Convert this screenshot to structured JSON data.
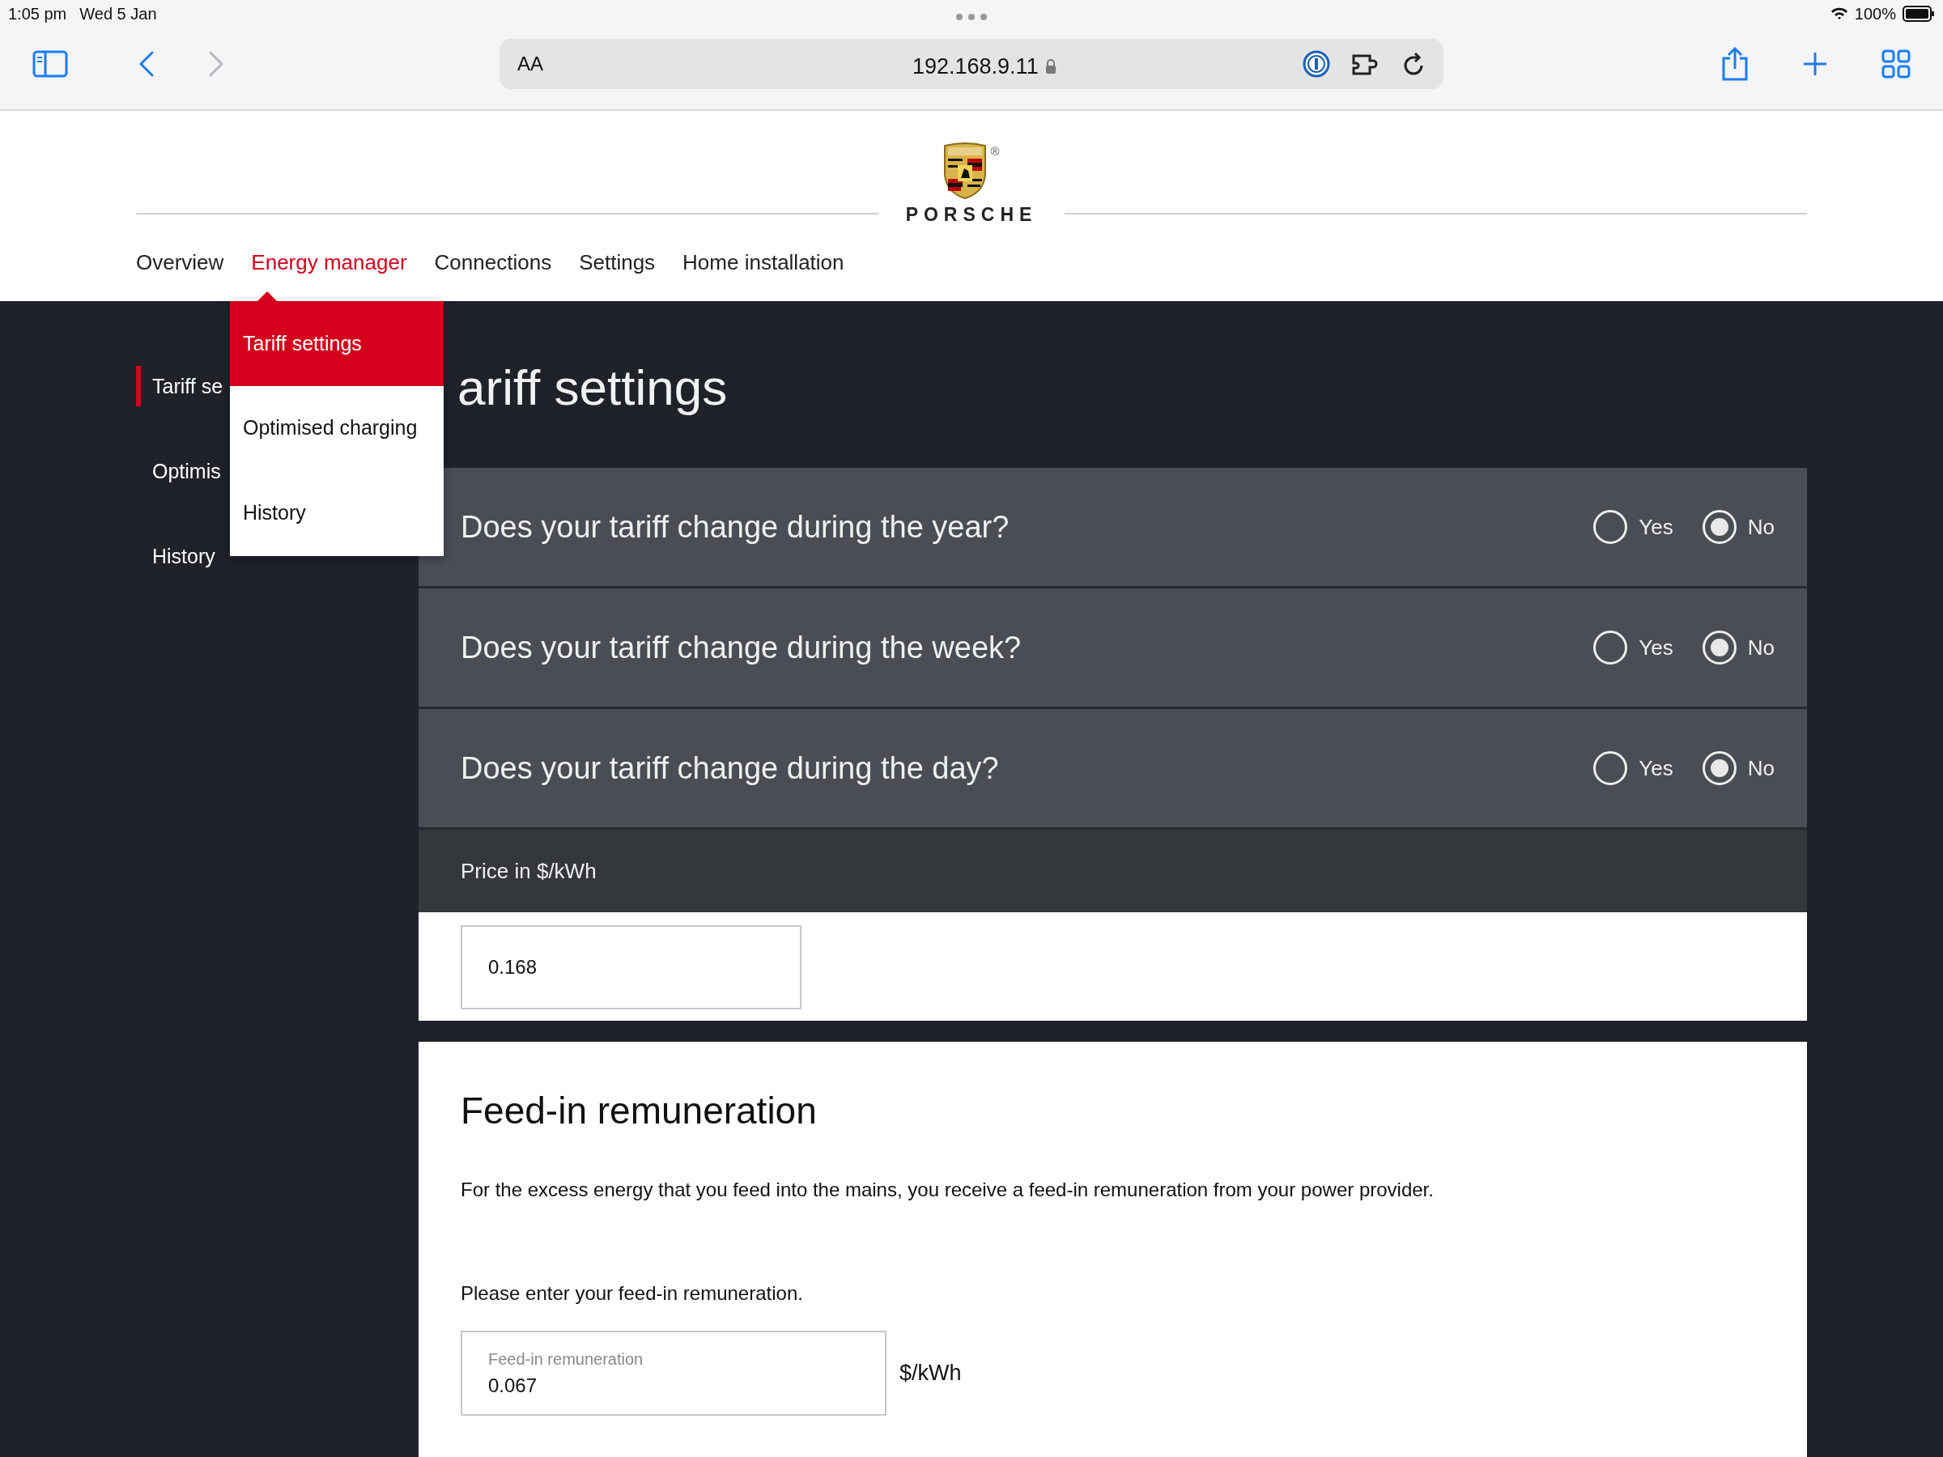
{
  "status_bar": {
    "time": "1:05 pm",
    "date": "Wed 5 Jan",
    "battery": "100%"
  },
  "browser": {
    "text_size_button": "AA",
    "address": "192.168.9.11",
    "nav_buttons": [
      {
        "kind": "back",
        "disabled": false
      },
      {
        "kind": "forward",
        "disabled": true
      }
    ]
  },
  "brand": {
    "registered": "®",
    "wordmark": "PORSCHE"
  },
  "nav": {
    "items": [
      {
        "label": "Overview",
        "selected": false
      },
      {
        "label": "Energy manager",
        "selected": true
      },
      {
        "label": "Connections",
        "selected": false
      },
      {
        "label": "Settings",
        "selected": false
      },
      {
        "label": "Home installation",
        "selected": false
      }
    ]
  },
  "dropdown": {
    "items": [
      {
        "label": "Tariff settings",
        "selected": true
      },
      {
        "label": "Optimised charging",
        "selected": false
      },
      {
        "label": "History",
        "selected": false
      }
    ]
  },
  "sidebar": {
    "items": [
      {
        "label": "Tariff se",
        "selected": true
      },
      {
        "label": "Optimis",
        "selected": false
      },
      {
        "label": "History",
        "selected": false
      }
    ]
  },
  "page_title": "ariff settings",
  "questions": [
    {
      "text": "Does your tariff change during the year?",
      "options": [
        {
          "label": "Yes",
          "selected": false
        },
        {
          "label": "No",
          "selected": true
        }
      ]
    },
    {
      "text": "Does your tariff change during the week?",
      "options": [
        {
          "label": "Yes",
          "selected": false
        },
        {
          "label": "No",
          "selected": true
        }
      ]
    },
    {
      "text": "Does your tariff change during the day?",
      "options": [
        {
          "label": "Yes",
          "selected": false
        },
        {
          "label": "No",
          "selected": true
        }
      ]
    }
  ],
  "price": {
    "label": "Price in $/kWh",
    "value": "0.168"
  },
  "feed_in": {
    "title": "Feed-in remuneration",
    "description": "For the excess energy that you feed into the mains, you receive a feed-in remuneration from your power provider.",
    "prompt": "Please enter your feed-in remuneration.",
    "field": {
      "label": "Feed-in remuneration",
      "value": "0.067"
    },
    "unit": "$/kWh"
  }
}
